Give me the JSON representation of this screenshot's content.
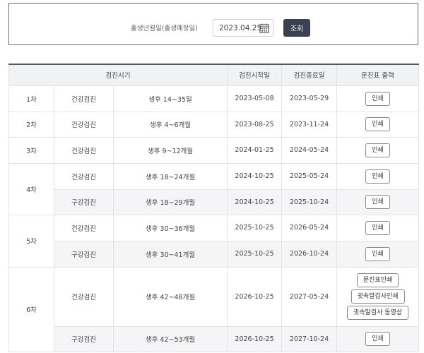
{
  "search": {
    "label": "출생년월일(출생예정일)",
    "date_value": "2023.04.25",
    "button_label": "조회"
  },
  "table": {
    "headers": [
      "검진시기",
      "검진시작일",
      "검진종료일",
      "문진표 출력"
    ],
    "print_label": "인쇄",
    "rows": [
      {
        "round": "1차",
        "type": "건강검진",
        "period": "생후 14~35일",
        "start": "2023-05-08",
        "end": "2023-05-29"
      },
      {
        "round": "2차",
        "type": "건강검진",
        "period": "생후 4~6개월",
        "start": "2023-08-25",
        "end": "2023-11-24"
      },
      {
        "round": "3차",
        "type": "건강검진",
        "period": "생후 9~12개월",
        "start": "2024-01-25",
        "end": "2024-05-24"
      },
      {
        "round": "4차",
        "type": "건강검진",
        "period": "생후 18~24개월",
        "start": "2024-10-25",
        "end": "2025-05-24"
      },
      {
        "round": "",
        "type": "구강검진",
        "period": "생후 18~29개월",
        "start": "2024-10-25",
        "end": "2025-10-24"
      },
      {
        "round": "5차",
        "type": "건강검진",
        "period": "생후 30~36개월",
        "start": "2025-10-25",
        "end": "2026-05-24"
      },
      {
        "round": "",
        "type": "구강검진",
        "period": "생후 30~41개월",
        "start": "2025-10-25",
        "end": "2026-10-24"
      },
      {
        "round": "6차",
        "type": "건강검진",
        "period": "생후 42~48개월",
        "start": "2026-10-25",
        "end": "2027-05-24"
      },
      {
        "round": "",
        "type": "구강검진",
        "period": "생후 42~53개월",
        "start": "2026-10-25",
        "end": "2027-10-24"
      }
    ],
    "row6_buttons": [
      "문진표인쇄",
      "귓속말검사인쇄",
      "귓속말검사 동영상"
    ]
  }
}
